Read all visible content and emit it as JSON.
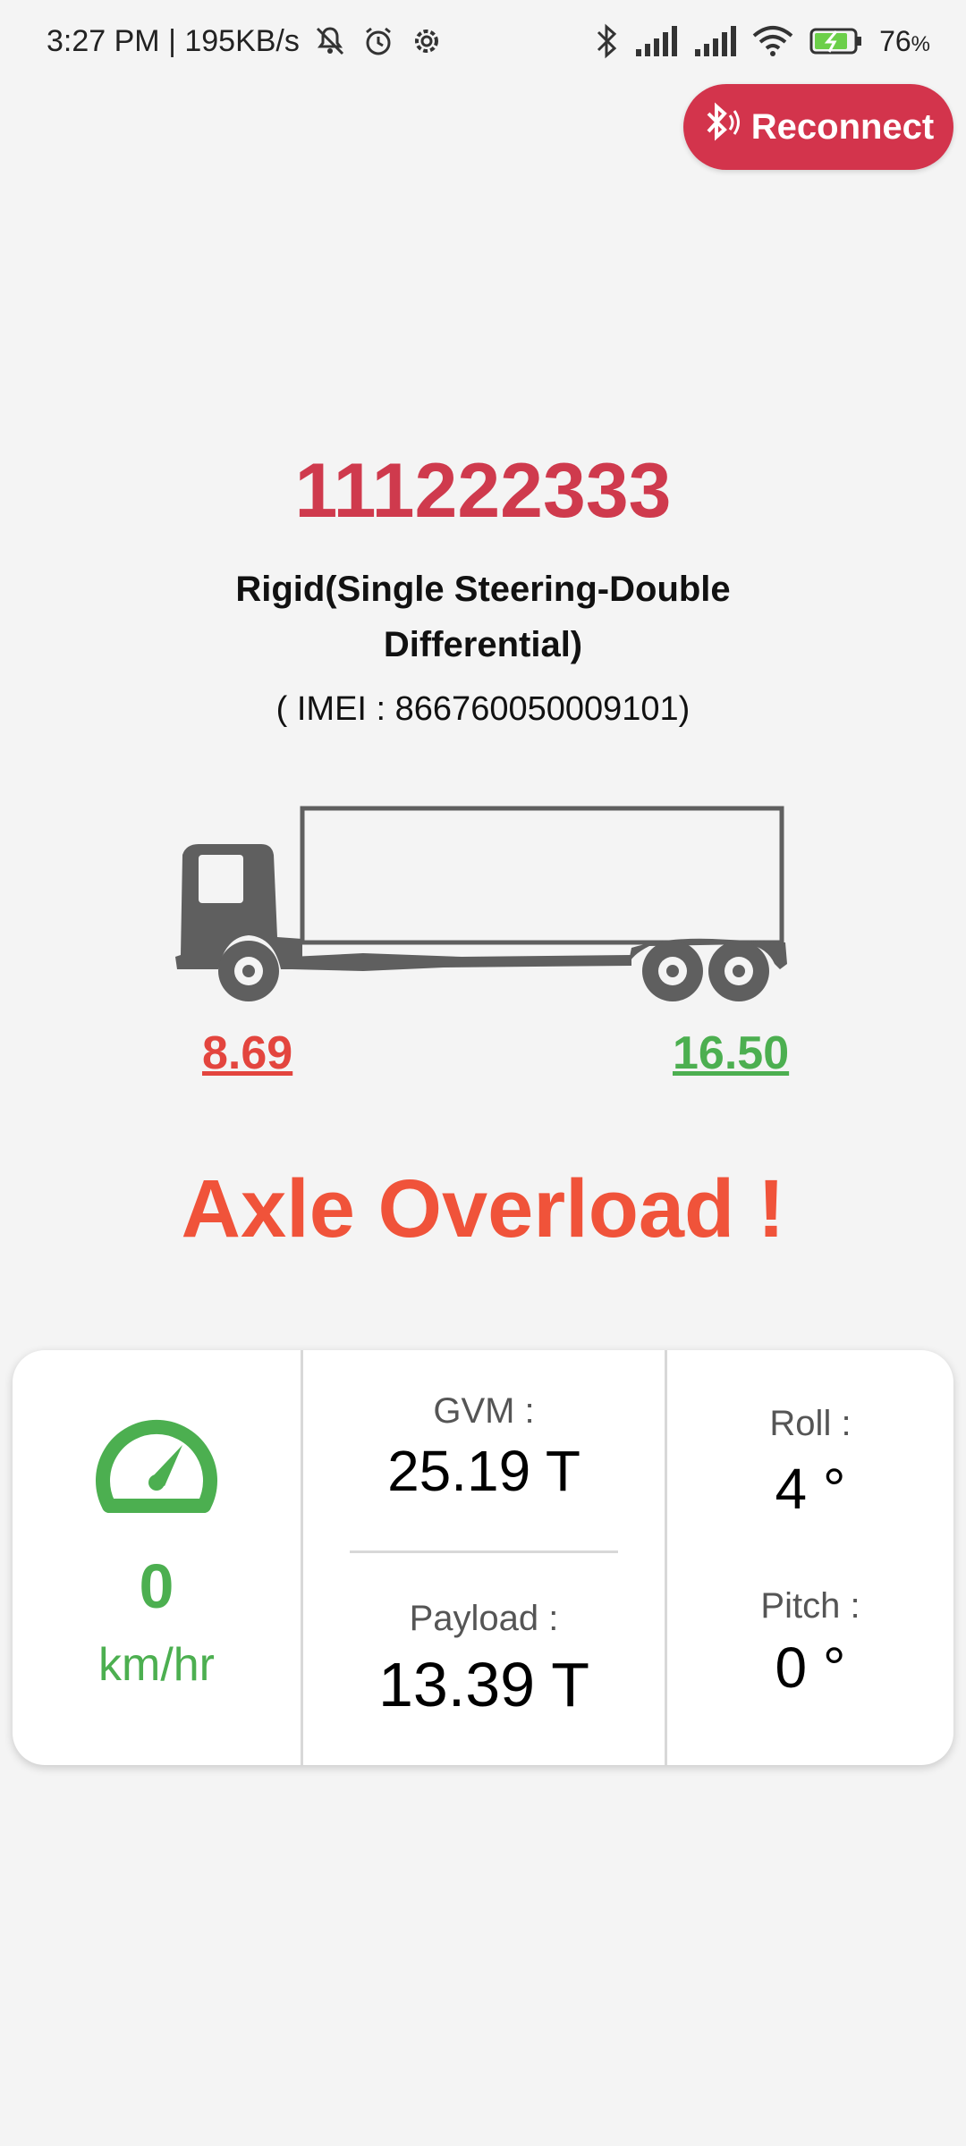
{
  "status_bar": {
    "time_speed": "3:27 PM | 195KB/s",
    "battery": "76",
    "battery_unit": "%"
  },
  "reconnect_label": "Reconnect",
  "vehicle": {
    "id": "111222333",
    "type": "Rigid(Single Steering-Double Differential)",
    "imei": "( IMEI : 866760050009101)"
  },
  "axles": {
    "front": "8.69",
    "rear": "16.50"
  },
  "alert": "Axle Overload !",
  "stats": {
    "speed_value": "0",
    "speed_unit": "km/hr",
    "gvm_label": "GVM :",
    "gvm_value": "25.19 T",
    "payload_label": "Payload :",
    "payload_value": "13.39 T",
    "roll_label": "Roll :",
    "roll_value": "4 °",
    "pitch_label": "Pitch :",
    "pitch_value": "0 °"
  },
  "colors": {
    "accent": "#cf3a4d",
    "alert": "#f0533a",
    "ok": "#4caf50",
    "overload": "#e3453e"
  }
}
